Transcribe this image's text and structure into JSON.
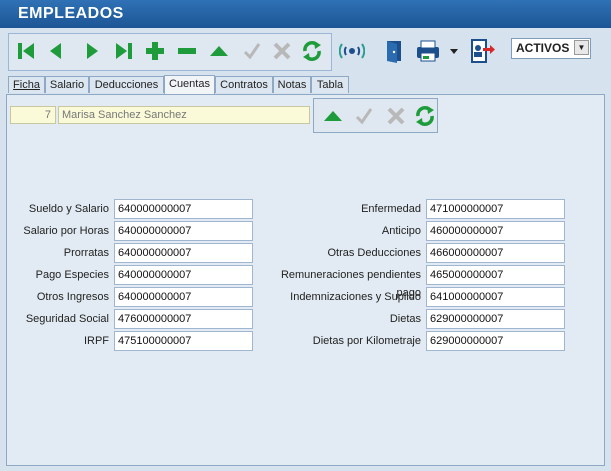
{
  "window": {
    "title": "EMPLEADOS"
  },
  "toolbar": {
    "buttons": [
      "first-record",
      "previous-record",
      "next-record",
      "last-record",
      "add-record",
      "delete-record",
      "edit-record",
      "confirm",
      "cancel",
      "refresh",
      "signal",
      "exit-door",
      "print",
      "user-transfer"
    ],
    "status_filter": "ACTIVOS"
  },
  "tabs": [
    "Ficha",
    "Salario",
    "Deducciones",
    "Cuentas",
    "Contratos",
    "Notas",
    "Tabla"
  ],
  "active_tab": "Cuentas",
  "record": {
    "id": "7",
    "name": "Marisa Sanchez Sanchez"
  },
  "accounts_left": [
    {
      "label": "Sueldo y Salario",
      "value": "640000000007"
    },
    {
      "label": "Salario por Horas",
      "value": "640000000007"
    },
    {
      "label": "Prorratas",
      "value": "640000000007"
    },
    {
      "label": "Pago Especies",
      "value": "640000000007"
    },
    {
      "label": "Otros Ingresos",
      "value": "640000000007"
    },
    {
      "label": "Seguridad Social",
      "value": "476000000007"
    },
    {
      "label": "IRPF",
      "value": "475100000007"
    }
  ],
  "accounts_right": [
    {
      "label": "Enfermedad",
      "value": "471000000007"
    },
    {
      "label": "Anticipo",
      "value": "460000000007"
    },
    {
      "label": "Otras Deducciones",
      "value": "466000000007"
    },
    {
      "label": "Remuneraciones pendientes pago",
      "value": "465000000007"
    },
    {
      "label": "Indemnizaciones y Suplido",
      "value": "641000000007"
    },
    {
      "label": "Dietas",
      "value": "629000000007"
    },
    {
      "label": "Dietas por Kilometraje",
      "value": "629000000007"
    }
  ],
  "colors": {
    "title_bar": "#1c5595",
    "nav_green": "#1e9b3a",
    "disabled_gray": "#b8b8b8",
    "panel": "#e2ebf3",
    "readonly_field": "#fafad8"
  }
}
